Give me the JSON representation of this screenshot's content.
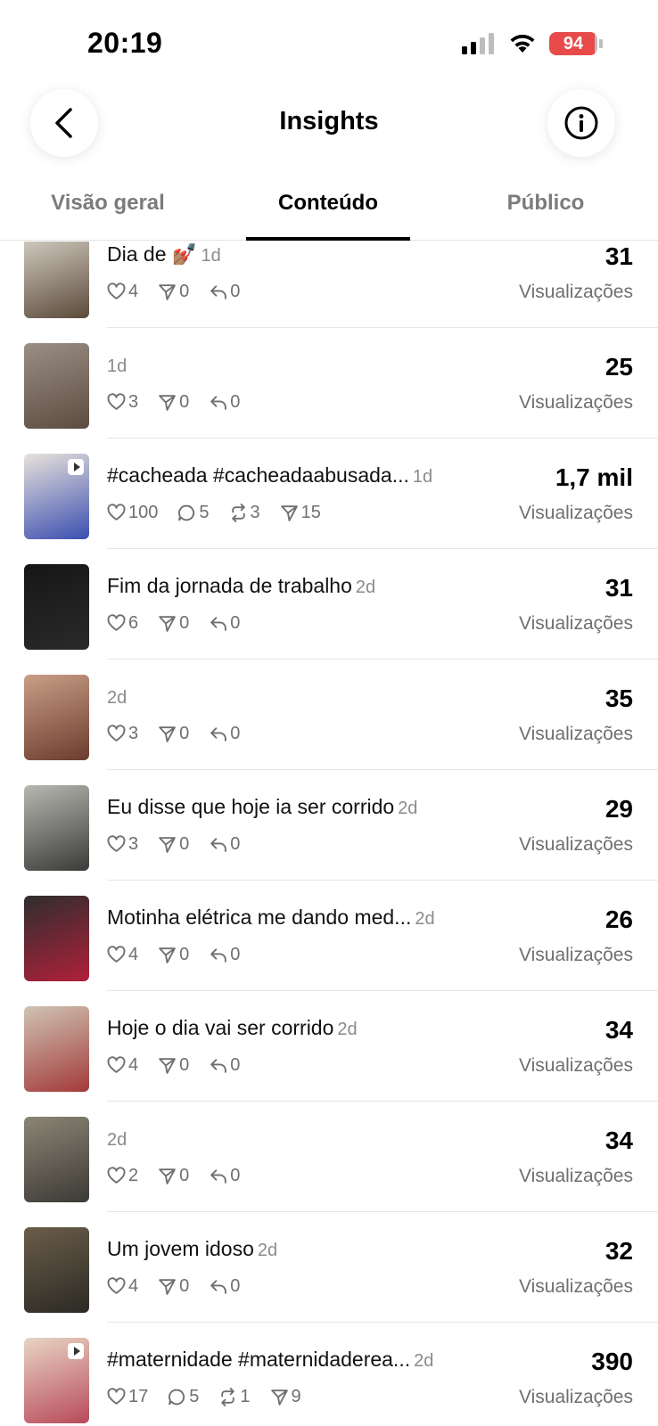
{
  "status_bar": {
    "time": "20:19",
    "battery": "94",
    "battery_level": 0.94,
    "battery_color": "#e84a4a"
  },
  "nav": {
    "title": "Insights",
    "back_icon": "chevron-left-icon",
    "info_icon": "info-icon"
  },
  "tabs": [
    {
      "label": "Visão geral",
      "active": false
    },
    {
      "label": "Conteúdo",
      "active": true
    },
    {
      "label": "Público",
      "active": false
    }
  ],
  "posts": [
    {
      "text": "Dia de 💅🏽",
      "age": "1d",
      "stats": [
        {
          "icon": "heart-icon",
          "value": "4"
        },
        {
          "icon": "send-icon",
          "value": "0"
        },
        {
          "icon": "reply-icon",
          "value": "0"
        }
      ],
      "views": "31",
      "views_label": "Visualizações",
      "thumb_colors": [
        "#d9d2c8",
        "#5a4a3a"
      ],
      "video": false
    },
    {
      "text": "",
      "age": "1d",
      "stats": [
        {
          "icon": "heart-icon",
          "value": "3"
        },
        {
          "icon": "send-icon",
          "value": "0"
        },
        {
          "icon": "reply-icon",
          "value": "0"
        }
      ],
      "views": "25",
      "views_label": "Visualizações",
      "thumb_colors": [
        "#9a8f86",
        "#5c4b40"
      ],
      "video": false
    },
    {
      "text": "#cacheada #cacheadaabusada...",
      "age": "1d",
      "stats": [
        {
          "icon": "heart-icon",
          "value": "100"
        },
        {
          "icon": "comment-icon",
          "value": "5"
        },
        {
          "icon": "repost-icon",
          "value": "3"
        },
        {
          "icon": "send-icon",
          "value": "15"
        }
      ],
      "views": "1,7 mil",
      "views_label": "Visualizações",
      "thumb_colors": [
        "#e8e2dc",
        "#3b4fb0"
      ],
      "video": true
    },
    {
      "text": "Fim da jornada de trabalho",
      "age": "2d",
      "stats": [
        {
          "icon": "heart-icon",
          "value": "6"
        },
        {
          "icon": "send-icon",
          "value": "0"
        },
        {
          "icon": "reply-icon",
          "value": "0"
        }
      ],
      "views": "31",
      "views_label": "Visualizações",
      "thumb_colors": [
        "#161616",
        "#2a2a2a"
      ],
      "video": false
    },
    {
      "text": "",
      "age": "2d",
      "stats": [
        {
          "icon": "heart-icon",
          "value": "3"
        },
        {
          "icon": "send-icon",
          "value": "0"
        },
        {
          "icon": "reply-icon",
          "value": "0"
        }
      ],
      "views": "35",
      "views_label": "Visualizações",
      "thumb_colors": [
        "#c99f86",
        "#6a3c2e"
      ],
      "video": false
    },
    {
      "text": "Eu disse que hoje ia ser corrido",
      "age": "2d",
      "stats": [
        {
          "icon": "heart-icon",
          "value": "3"
        },
        {
          "icon": "send-icon",
          "value": "0"
        },
        {
          "icon": "reply-icon",
          "value": "0"
        }
      ],
      "views": "29",
      "views_label": "Visualizações",
      "thumb_colors": [
        "#b8b8b2",
        "#3a3a38"
      ],
      "video": false
    },
    {
      "text": "Motinha elétrica me dando med...",
      "age": "2d",
      "stats": [
        {
          "icon": "heart-icon",
          "value": "4"
        },
        {
          "icon": "send-icon",
          "value": "0"
        },
        {
          "icon": "reply-icon",
          "value": "0"
        }
      ],
      "views": "26",
      "views_label": "Visualizações",
      "thumb_colors": [
        "#2e2e2e",
        "#b0203a"
      ],
      "video": false
    },
    {
      "text": "Hoje o dia vai ser corrido",
      "age": "2d",
      "stats": [
        {
          "icon": "heart-icon",
          "value": "4"
        },
        {
          "icon": "send-icon",
          "value": "0"
        },
        {
          "icon": "reply-icon",
          "value": "0"
        }
      ],
      "views": "34",
      "views_label": "Visualizações",
      "thumb_colors": [
        "#cfc3b3",
        "#a33a3a"
      ],
      "video": false
    },
    {
      "text": "",
      "age": "2d",
      "stats": [
        {
          "icon": "heart-icon",
          "value": "2"
        },
        {
          "icon": "send-icon",
          "value": "0"
        },
        {
          "icon": "reply-icon",
          "value": "0"
        }
      ],
      "views": "34",
      "views_label": "Visualizações",
      "thumb_colors": [
        "#8c8576",
        "#3c3a35"
      ],
      "video": false
    },
    {
      "text": "Um jovem idoso",
      "age": "2d",
      "stats": [
        {
          "icon": "heart-icon",
          "value": "4"
        },
        {
          "icon": "send-icon",
          "value": "0"
        },
        {
          "icon": "reply-icon",
          "value": "0"
        }
      ],
      "views": "32",
      "views_label": "Visualizações",
      "thumb_colors": [
        "#6b5d4a",
        "#2b2a24"
      ],
      "video": false
    },
    {
      "text": "#maternidade #maternidaderea...",
      "age": "2d",
      "stats": [
        {
          "icon": "heart-icon",
          "value": "17"
        },
        {
          "icon": "comment-icon",
          "value": "5"
        },
        {
          "icon": "repost-icon",
          "value": "1"
        },
        {
          "icon": "send-icon",
          "value": "9"
        }
      ],
      "views": "390",
      "views_label": "Visualizações",
      "thumb_colors": [
        "#e8d5c4",
        "#b84a5a"
      ],
      "video": true
    }
  ]
}
